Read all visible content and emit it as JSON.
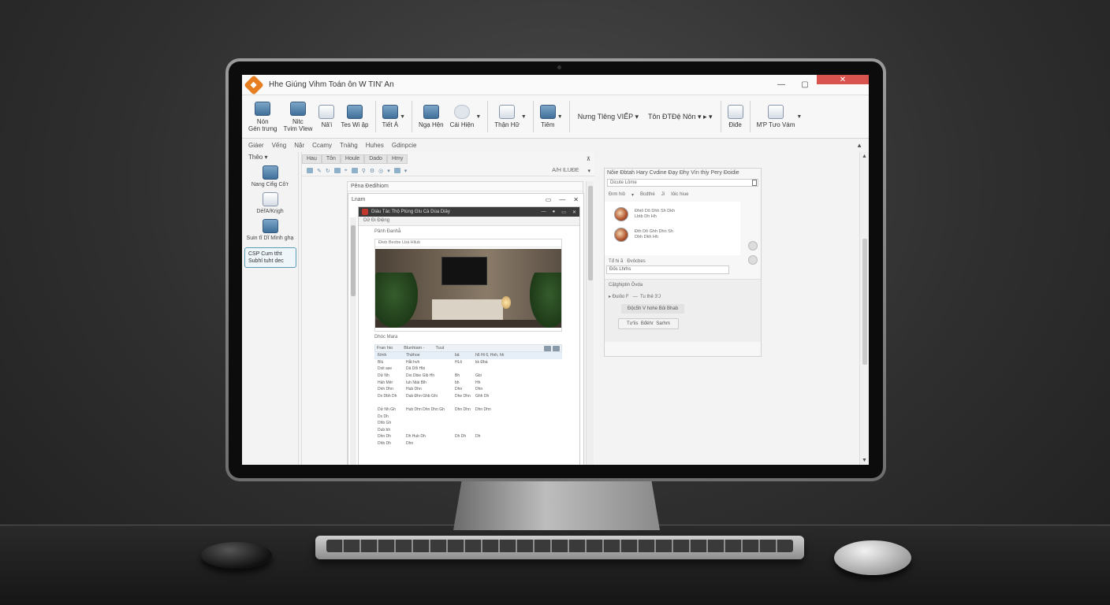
{
  "window": {
    "title": "Hhe Giúng Vihm Toán ôn W TIN' An"
  },
  "ribbon": {
    "buttons": [
      {
        "label": "Nón\nGén trưng",
        "icon": "monitor-icon"
      },
      {
        "label": "Nitc\nTvim Vlew",
        "icon": "monitor-icon"
      },
      {
        "label": "Nâ'i",
        "icon": "edit-icon"
      },
      {
        "label": "Tes Wi ập",
        "icon": "monitor-icon"
      },
      {
        "label": "Tiết À",
        "icon": "monitor-icon"
      },
      {
        "label": "Ngạ Hện",
        "icon": "monitor-icon"
      },
      {
        "label": "Cái Hiện",
        "icon": "cloud-icon"
      },
      {
        "label": "Thận Hữ",
        "icon": "computer-icon"
      },
      {
        "label": "Tiêm",
        "icon": "pen-icon"
      },
      {
        "label": "Điđe",
        "icon": "trash-icon"
      },
      {
        "label": "M'P Tưo Vám",
        "icon": "document-icon"
      }
    ],
    "dropdown1": "Nưng Tlêng VIẾP",
    "dropdown2": "Tôn ĐTĐệ Nôn"
  },
  "menubar": [
    "Giáer",
    "Vếng",
    "Nặr",
    "Ccamy",
    "Tnàhg",
    "Huhes",
    "Gdinpcie"
  ],
  "sidebar": {
    "header": "Thêo",
    "items": [
      "Nang Cifig Cô'r",
      "DéřA/Krịgh",
      "Suin tĩ Dĩ Mình ghạ"
    ],
    "box": "CSP Cum ttht\nSubhl tuht dec"
  },
  "middle": {
    "tabs": [
      "Haụ",
      "Tôn",
      "Houle",
      "Dado",
      "Hmy"
    ],
    "tools_right": "A/H ILUĐE",
    "doc_title": "Pêna Đedihiom",
    "inner_title": "Lnam",
    "browser_tab": "Diáu Tác Thộ Ptúng Glu Cà Dùa Diây",
    "browser_url": "Dữ Đi Điệng",
    "browser_heading": "Pânh Đanhằ",
    "card_toolbar": "Đieb   Bexbe   Lbá   Hilub",
    "sub_heading": "Dhóc Mara",
    "table_headers": [
      "Fran hio",
      "Blunhiam -",
      "Tuut"
    ],
    "rows": [
      [
        "Ilớnh",
        "Thứhoe",
        "bả",
        "h6 Ht 6, Hnh, hh"
      ],
      [
        "Blù",
        "Hẫt hvh",
        "HLô",
        "kk Đbá"
      ],
      [
        "Dxit ase",
        "Dả Dổi Hbi",
        "",
        ""
      ],
      [
        "Dử Nh",
        "Doi Dbie Glb Hh",
        "Bh",
        "Gbi"
      ],
      [
        "Hàh Mêr",
        "Iuh Ntái Blh",
        "bh",
        "Hh"
      ],
      [
        "Dnh Dhn",
        "Hub Dhn",
        "Dhn",
        "Dhn"
      ],
      [
        "Dx Dbh Dh",
        "Dub Đhn Ghb Ghi",
        "Dhe Dhn",
        "Ghh Dh"
      ],
      [
        "",
        "",
        "",
        ""
      ],
      [
        "Dử Nh Gh",
        "Hub Dhn Dhn Dhn Gh",
        "Dhn Dhn",
        "Dhn Dhn"
      ],
      [
        "Dx Dh",
        "",
        "",
        ""
      ],
      [
        "Dhb Gh",
        "",
        "",
        ""
      ],
      [
        "Dub bh",
        "",
        "",
        ""
      ],
      [
        "Dhn Dh",
        "Dh Hub Dh",
        "Dh Dh",
        "Dh"
      ],
      [
        "Dhb Dh",
        "Dhn",
        "",
        ""
      ]
    ]
  },
  "right_panel": {
    "title": "Nôie Đbtah Hary Cvdine Đạy Đhy Vín thịy Pery Đoidie",
    "search": "Dicute Lôme",
    "filters": [
      "Đrm hiô",
      "Bcdthé",
      "Ji",
      "Iôic hiue"
    ],
    "items": [
      "Đhiô Dô Dhh Sh Dkh\nLbtb Dh Hh",
      "Đth Dô Ghh Dhn Sh\nDhh Dkh Hh"
    ],
    "field_labels": [
      "Tđ hi ã",
      "Đvôcbes"
    ],
    "field_value": "Đốs Lhrhs",
    "section": "Cặtghiptin Ôvda",
    "row": "Đuiôo F",
    "row_right": "Tu thẻ 3'J",
    "pill": "Độc5h V   hohe   Bủi Bhab",
    "buttons": [
      "Tư'iis",
      "Bđéhr",
      "Sarhm"
    ]
  }
}
